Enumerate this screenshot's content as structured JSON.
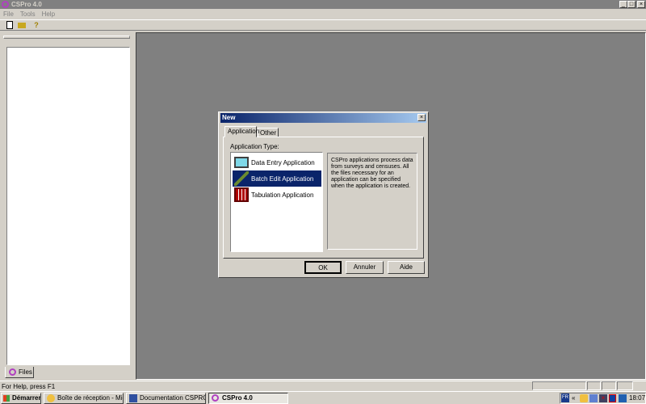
{
  "window": {
    "title": "CSPro 4.0",
    "min": "_",
    "max": "□",
    "close": "×"
  },
  "menu": [
    "File",
    "Tools",
    "Help"
  ],
  "toolbar": {
    "icons": [
      "new-file-icon",
      "open-folder-icon",
      "help-icon"
    ]
  },
  "left_panel": {
    "tab_label": "Files"
  },
  "status_bar": {
    "text": "For Help, press F1"
  },
  "dialog": {
    "title": "New",
    "tabs": [
      {
        "label": "Application",
        "active": true
      },
      {
        "label": "Other",
        "active": false
      }
    ],
    "group_label": "Application Type:",
    "items": [
      {
        "label": "Data Entry Application",
        "icon": "monitor-icon",
        "selected": false
      },
      {
        "label": "Batch Edit Application",
        "icon": "pencil-icon",
        "selected": true
      },
      {
        "label": "Tabulation Application",
        "icon": "table-grid-icon",
        "selected": false
      }
    ],
    "description": "CSPro applications process data from surveys and censuses.  All the files necessary for an application can be specified when the application is created.",
    "buttons": {
      "ok": "OK",
      "cancel": "Annuler",
      "help": "Aide"
    },
    "close": "×"
  },
  "taskbar": {
    "start": "Démarrer",
    "tasks": [
      {
        "label": "Boîte de réception - Mic...",
        "active": false
      },
      {
        "label": "Documentation CSPRO v...",
        "active": false
      },
      {
        "label": "CSPro 4.0",
        "active": true
      }
    ],
    "tray": {
      "lang": "FR",
      "chevron": "«",
      "clock": "18:07"
    }
  },
  "colors": {
    "selection": "#0a246a",
    "desktop": "#808080",
    "face": "#d4d0c8"
  }
}
